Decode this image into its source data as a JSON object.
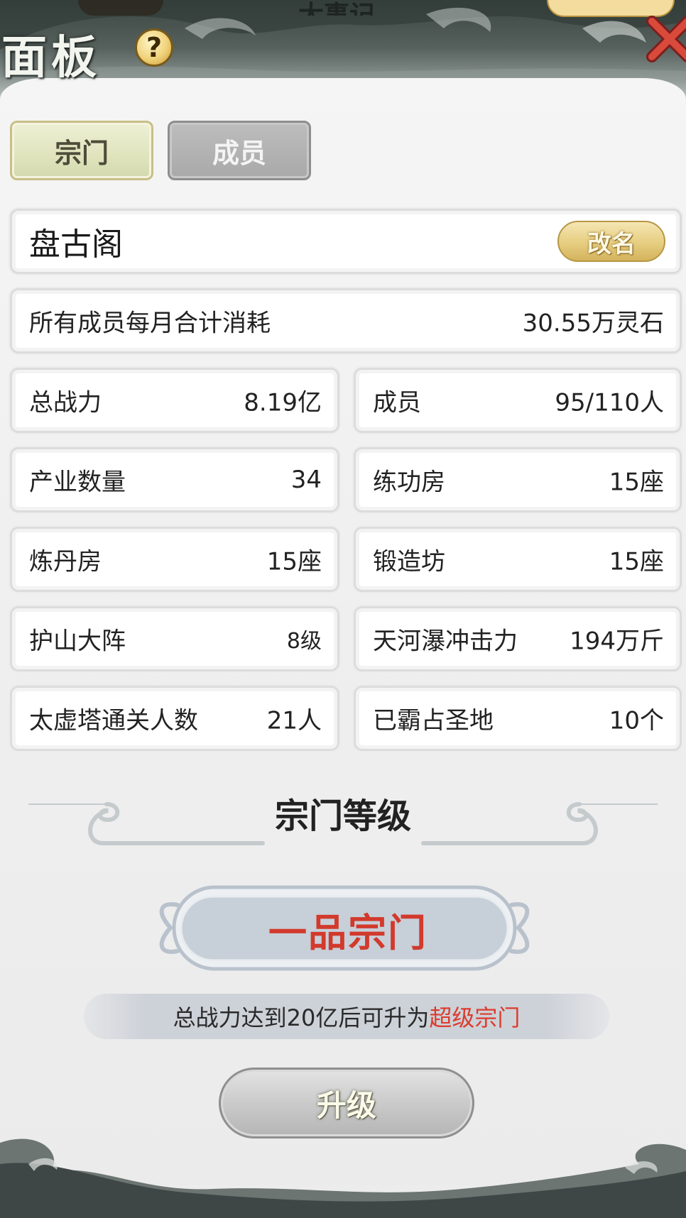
{
  "header": {
    "title": "面板",
    "top_clipped_text": "大事记"
  },
  "tabs": [
    {
      "label": "宗门",
      "active": true
    },
    {
      "label": "成员",
      "active": false
    }
  ],
  "sect": {
    "name": "盘古阁",
    "rename_label": "改名",
    "consumption": {
      "label": "所有成员每月合计消耗",
      "value": "30.55万灵石"
    }
  },
  "stats": [
    {
      "label": "总战力",
      "value": "8.19亿"
    },
    {
      "label": "成员",
      "value": "95/110人"
    },
    {
      "label": "产业数量",
      "value": "34"
    },
    {
      "label": "练功房",
      "value": "15座"
    },
    {
      "label": "炼丹房",
      "value": "15座"
    },
    {
      "label": "锻造坊",
      "value": "15座"
    },
    {
      "label": "护山大阵",
      "value": "8级"
    },
    {
      "label": "天河瀑冲击力",
      "value": "194万斤"
    },
    {
      "label": "太虚塔通关人数",
      "value": "21人"
    },
    {
      "label": "已霸占圣地",
      "value": "10个"
    }
  ],
  "level": {
    "heading": "宗门等级",
    "current": "一品宗门",
    "hint_prefix": "总战力达到20亿后可升为",
    "hint_target": "超级宗门",
    "upgrade_label": "升级"
  },
  "colors": {
    "accent_red": "#d23a2c",
    "gold": "#e6cd80",
    "tab_active": "#dfe4bd"
  },
  "icons": {
    "help": "help-icon",
    "close": "close-icon"
  }
}
